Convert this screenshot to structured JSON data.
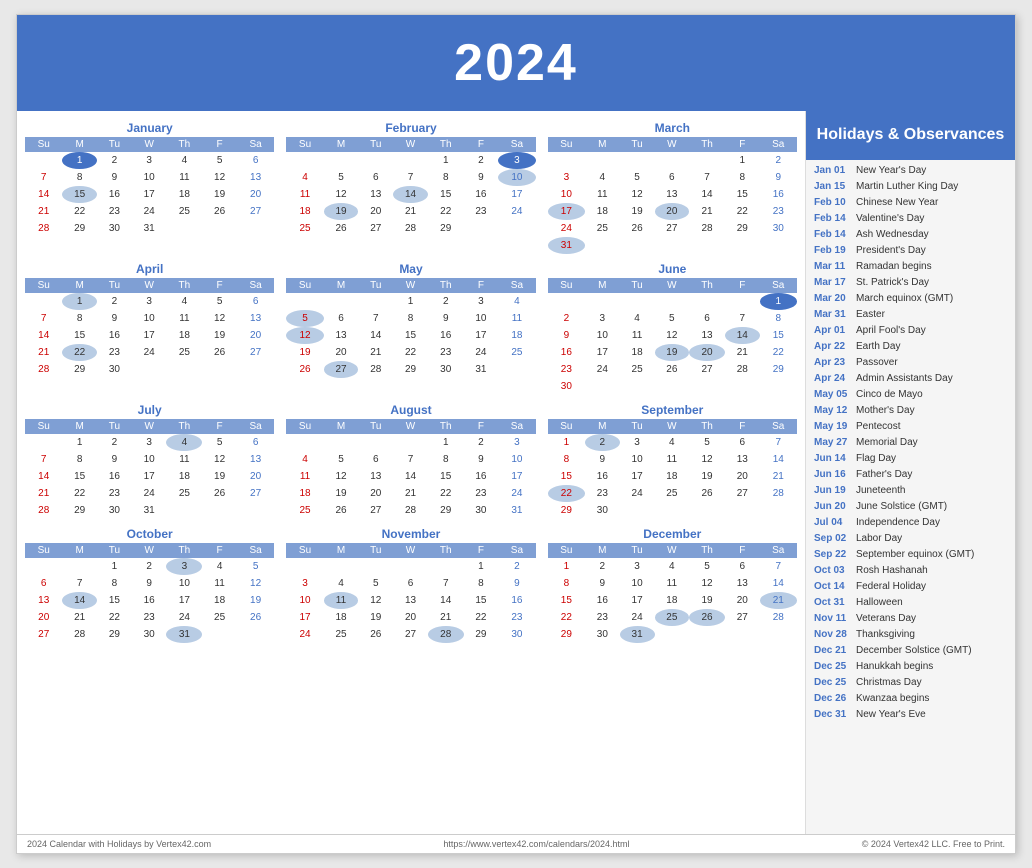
{
  "header": {
    "year": "2024",
    "title": "2024"
  },
  "sidebar": {
    "title": "Holidays & Observances",
    "holidays": [
      {
        "date": "Jan 01",
        "name": "New Year's Day"
      },
      {
        "date": "Jan 15",
        "name": "Martin Luther King Day"
      },
      {
        "date": "Feb 10",
        "name": "Chinese New Year"
      },
      {
        "date": "Feb 14",
        "name": "Valentine's Day"
      },
      {
        "date": "Feb 14",
        "name": "Ash Wednesday"
      },
      {
        "date": "Feb 19",
        "name": "President's Day"
      },
      {
        "date": "Mar 11",
        "name": "Ramadan begins"
      },
      {
        "date": "Mar 17",
        "name": "St. Patrick's Day"
      },
      {
        "date": "Mar 20",
        "name": "March equinox (GMT)"
      },
      {
        "date": "Mar 31",
        "name": "Easter"
      },
      {
        "date": "Apr 01",
        "name": "April Fool's Day"
      },
      {
        "date": "Apr 22",
        "name": "Earth Day"
      },
      {
        "date": "Apr 23",
        "name": "Passover"
      },
      {
        "date": "Apr 24",
        "name": "Admin Assistants Day"
      },
      {
        "date": "May 05",
        "name": "Cinco de Mayo"
      },
      {
        "date": "May 12",
        "name": "Mother's Day"
      },
      {
        "date": "May 19",
        "name": "Pentecost"
      },
      {
        "date": "May 27",
        "name": "Memorial Day"
      },
      {
        "date": "Jun 14",
        "name": "Flag Day"
      },
      {
        "date": "Jun 16",
        "name": "Father's Day"
      },
      {
        "date": "Jun 19",
        "name": "Juneteenth"
      },
      {
        "date": "Jun 20",
        "name": "June Solstice (GMT)"
      },
      {
        "date": "Jul 04",
        "name": "Independence Day"
      },
      {
        "date": "Sep 02",
        "name": "Labor Day"
      },
      {
        "date": "Sep 22",
        "name": "September equinox (GMT)"
      },
      {
        "date": "Oct 03",
        "name": "Rosh Hashanah"
      },
      {
        "date": "Oct 14",
        "name": "Federal Holiday"
      },
      {
        "date": "Oct 31",
        "name": "Halloween"
      },
      {
        "date": "Nov 11",
        "name": "Veterans Day"
      },
      {
        "date": "Nov 28",
        "name": "Thanksgiving"
      },
      {
        "date": "Dec 21",
        "name": "December Solstice (GMT)"
      },
      {
        "date": "Dec 25",
        "name": "Hanukkah begins"
      },
      {
        "date": "Dec 25",
        "name": "Christmas Day"
      },
      {
        "date": "Dec 26",
        "name": "Kwanzaa begins"
      },
      {
        "date": "Dec 31",
        "name": "New Year's Eve"
      }
    ]
  },
  "footer": {
    "left": "2024 Calendar with Holidays by Vertex42.com",
    "center": "https://www.vertex42.com/calendars/2024.html",
    "right": "© 2024 Vertex42 LLC. Free to Print."
  },
  "months": [
    {
      "name": "January",
      "weeks": [
        [
          "",
          "1",
          "2",
          "3",
          "4",
          "5",
          "6"
        ],
        [
          "7",
          "8",
          "9",
          "10",
          "11",
          "12",
          "13"
        ],
        [
          "14",
          "15",
          "16",
          "17",
          "18",
          "19",
          "20"
        ],
        [
          "21",
          "22",
          "23",
          "24",
          "25",
          "26",
          "27"
        ],
        [
          "28",
          "29",
          "30",
          "31",
          "",
          "",
          ""
        ]
      ],
      "highlights": {
        "1": "holiday-blue",
        "15": "holiday"
      }
    },
    {
      "name": "February",
      "weeks": [
        [
          "",
          "",
          "",
          "",
          "1",
          "2",
          "3"
        ],
        [
          "4",
          "5",
          "6",
          "7",
          "8",
          "9",
          "10"
        ],
        [
          "11",
          "12",
          "13",
          "14",
          "15",
          "16",
          "17"
        ],
        [
          "18",
          "19",
          "20",
          "21",
          "22",
          "23",
          "24"
        ],
        [
          "25",
          "26",
          "27",
          "28",
          "29",
          "",
          ""
        ]
      ],
      "highlights": {
        "3": "sat-blue",
        "10": "holiday",
        "14": "holiday",
        "19": "holiday"
      }
    },
    {
      "name": "March",
      "weeks": [
        [
          "",
          "",
          "",
          "",
          "",
          "1",
          "2"
        ],
        [
          "3",
          "4",
          "5",
          "6",
          "7",
          "8",
          "9"
        ],
        [
          "10",
          "11",
          "12",
          "13",
          "14",
          "15",
          "16"
        ],
        [
          "17",
          "18",
          "19",
          "20",
          "21",
          "22",
          "23"
        ],
        [
          "24",
          "25",
          "26",
          "27",
          "28",
          "29",
          "30"
        ],
        [
          "31",
          "",
          "",
          "",
          "",
          "",
          ""
        ]
      ],
      "highlights": {
        "17": "holiday",
        "20": "holiday",
        "31": "holiday"
      }
    },
    {
      "name": "April",
      "weeks": [
        [
          "",
          "1",
          "2",
          "3",
          "4",
          "5",
          "6"
        ],
        [
          "7",
          "8",
          "9",
          "10",
          "11",
          "12",
          "13"
        ],
        [
          "14",
          "15",
          "16",
          "17",
          "18",
          "19",
          "20"
        ],
        [
          "21",
          "22",
          "23",
          "24",
          "25",
          "26",
          "27"
        ],
        [
          "28",
          "29",
          "30",
          "",
          "",
          "",
          ""
        ]
      ],
      "highlights": {
        "1": "holiday",
        "22": "holiday"
      }
    },
    {
      "name": "May",
      "weeks": [
        [
          "",
          "",
          "",
          "1",
          "2",
          "3",
          "4"
        ],
        [
          "5",
          "6",
          "7",
          "8",
          "9",
          "10",
          "11"
        ],
        [
          "12",
          "13",
          "14",
          "15",
          "16",
          "17",
          "18"
        ],
        [
          "19",
          "20",
          "21",
          "22",
          "23",
          "24",
          "25"
        ],
        [
          "26",
          "27",
          "28",
          "29",
          "30",
          "31",
          ""
        ]
      ],
      "highlights": {
        "5": "holiday",
        "12": "holiday",
        "27": "holiday"
      }
    },
    {
      "name": "June",
      "weeks": [
        [
          "",
          "",
          "",
          "",
          "",
          "",
          "1"
        ],
        [
          "2",
          "3",
          "4",
          "5",
          "6",
          "7",
          "8"
        ],
        [
          "9",
          "10",
          "11",
          "12",
          "13",
          "14",
          "15"
        ],
        [
          "16",
          "17",
          "18",
          "19",
          "20",
          "21",
          "22"
        ],
        [
          "23",
          "24",
          "25",
          "26",
          "27",
          "28",
          "29"
        ],
        [
          "30",
          "",
          "",
          "",
          "",
          "",
          ""
        ]
      ],
      "highlights": {
        "1": "sat-blue",
        "14": "holiday",
        "19": "holiday",
        "20": "holiday"
      }
    },
    {
      "name": "July",
      "weeks": [
        [
          "",
          "1",
          "2",
          "3",
          "4",
          "5",
          "6"
        ],
        [
          "7",
          "8",
          "9",
          "10",
          "11",
          "12",
          "13"
        ],
        [
          "14",
          "15",
          "16",
          "17",
          "18",
          "19",
          "20"
        ],
        [
          "21",
          "22",
          "23",
          "24",
          "25",
          "26",
          "27"
        ],
        [
          "28",
          "29",
          "30",
          "31",
          "",
          "",
          ""
        ]
      ],
      "highlights": {
        "4": "holiday"
      }
    },
    {
      "name": "August",
      "weeks": [
        [
          "",
          "",
          "",
          "",
          "1",
          "2",
          "3"
        ],
        [
          "4",
          "5",
          "6",
          "7",
          "8",
          "9",
          "10"
        ],
        [
          "11",
          "12",
          "13",
          "14",
          "15",
          "16",
          "17"
        ],
        [
          "18",
          "19",
          "20",
          "21",
          "22",
          "23",
          "24"
        ],
        [
          "25",
          "26",
          "27",
          "28",
          "29",
          "30",
          "31"
        ]
      ],
      "highlights": {}
    },
    {
      "name": "September",
      "weeks": [
        [
          "1",
          "2",
          "3",
          "4",
          "5",
          "6",
          "7"
        ],
        [
          "8",
          "9",
          "10",
          "11",
          "12",
          "13",
          "14"
        ],
        [
          "15",
          "16",
          "17",
          "18",
          "19",
          "20",
          "21"
        ],
        [
          "22",
          "23",
          "24",
          "25",
          "26",
          "27",
          "28"
        ],
        [
          "29",
          "30",
          "",
          "",
          "",
          "",
          ""
        ]
      ],
      "highlights": {
        "2": "holiday",
        "22": "holiday"
      }
    },
    {
      "name": "October",
      "weeks": [
        [
          "",
          "",
          "1",
          "2",
          "3",
          "4",
          "5"
        ],
        [
          "6",
          "7",
          "8",
          "9",
          "10",
          "11",
          "12"
        ],
        [
          "13",
          "14",
          "15",
          "16",
          "17",
          "18",
          "19"
        ],
        [
          "20",
          "21",
          "22",
          "23",
          "24",
          "25",
          "26"
        ],
        [
          "27",
          "28",
          "29",
          "30",
          "31",
          "",
          ""
        ]
      ],
      "highlights": {
        "3": "holiday",
        "14": "holiday",
        "31": "holiday"
      }
    },
    {
      "name": "November",
      "weeks": [
        [
          "",
          "",
          "",
          "",
          "",
          "1",
          "2"
        ],
        [
          "3",
          "4",
          "5",
          "6",
          "7",
          "8",
          "9"
        ],
        [
          "10",
          "11",
          "12",
          "13",
          "14",
          "15",
          "16"
        ],
        [
          "17",
          "18",
          "19",
          "20",
          "21",
          "22",
          "23"
        ],
        [
          "24",
          "25",
          "26",
          "27",
          "28",
          "29",
          "30"
        ]
      ],
      "highlights": {
        "11": "holiday",
        "28": "holiday"
      }
    },
    {
      "name": "December",
      "weeks": [
        [
          "1",
          "2",
          "3",
          "4",
          "5",
          "6",
          "7"
        ],
        [
          "8",
          "9",
          "10",
          "11",
          "12",
          "13",
          "14"
        ],
        [
          "15",
          "16",
          "17",
          "18",
          "19",
          "20",
          "21"
        ],
        [
          "22",
          "23",
          "24",
          "25",
          "26",
          "27",
          "28"
        ],
        [
          "29",
          "30",
          "31",
          "",
          "",
          "",
          ""
        ]
      ],
      "highlights": {
        "21": "holiday",
        "25": "holiday",
        "26": "holiday",
        "31": "holiday"
      }
    }
  ],
  "dayHeaders": [
    "Su",
    "M",
    "Tu",
    "W",
    "Th",
    "F",
    "Sa"
  ]
}
